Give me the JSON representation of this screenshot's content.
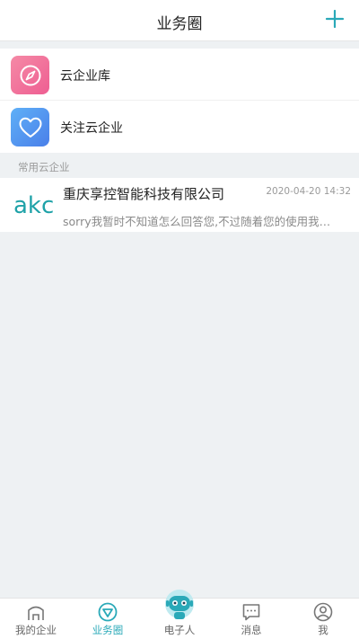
{
  "header": {
    "title": "业务圈",
    "add_icon": "plus-icon"
  },
  "entries": [
    {
      "label": "云企业库",
      "icon": "compass-icon",
      "color": "#f06b9a"
    },
    {
      "label": "关注云企业",
      "icon": "heart-icon",
      "color": "#4a8ef0"
    }
  ],
  "section": {
    "label": "常用云企业"
  },
  "companies": [
    {
      "logo_text": "akc",
      "name": "重庆享控智能科技有限公司",
      "time": "2020-04-20 14:32",
      "message": "sorry我暂时不知道怎么回答您,不过随着您的使用我…"
    }
  ],
  "tabs": [
    {
      "label": "我的企业",
      "icon": "home-icon"
    },
    {
      "label": "业务圈",
      "icon": "circle-triangle-icon",
      "active": true
    },
    {
      "label": "电子人",
      "icon": "robot-icon"
    },
    {
      "label": "消息",
      "icon": "chat-icon"
    },
    {
      "label": "我",
      "icon": "user-icon"
    }
  ],
  "colors": {
    "accent": "#2aa9b8",
    "logo": "#1fa2a8",
    "background": "#eef1f3"
  }
}
